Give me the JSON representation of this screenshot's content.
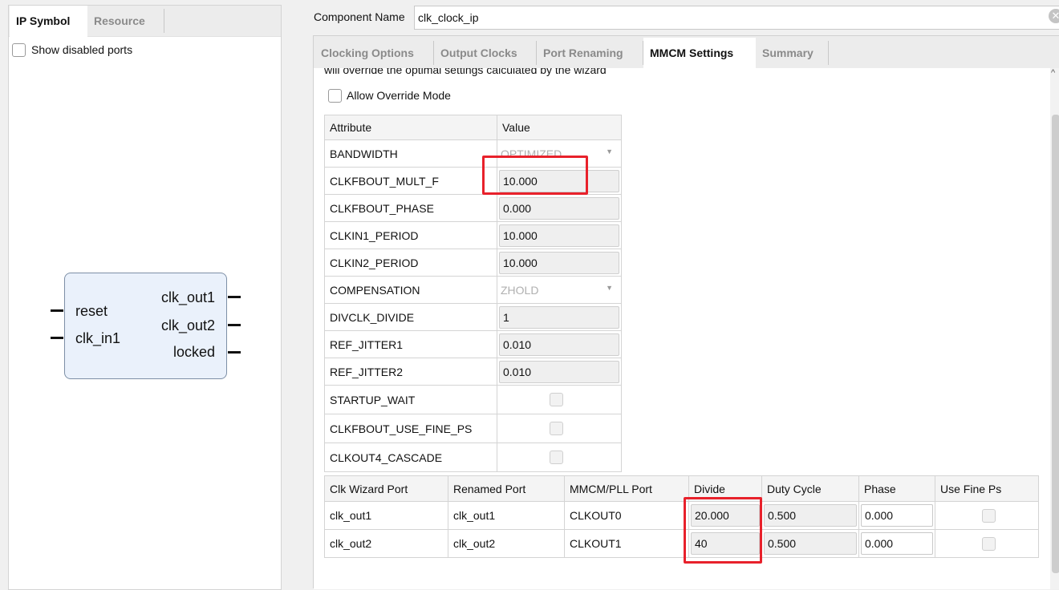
{
  "left_panel": {
    "tabs": [
      {
        "label": "IP Symbol",
        "active": true
      },
      {
        "label": "Resource",
        "active": false
      }
    ],
    "show_disabled_ports": {
      "label": "Show disabled ports",
      "checked": false
    },
    "symbol": {
      "inputs": [
        "reset",
        "clk_in1"
      ],
      "outputs": [
        "clk_out1",
        "clk_out2",
        "locked"
      ],
      "fill_color": "#eaf1fb"
    }
  },
  "component_name": {
    "label": "Component Name",
    "value": "clk_clock_ip",
    "clear_icon": "clear-circle-icon"
  },
  "tabs": [
    {
      "label": "Clocking Options"
    },
    {
      "label": "Output Clocks"
    },
    {
      "label": "Port Renaming"
    },
    {
      "label": "MMCM Settings",
      "active": true
    },
    {
      "label": "Summary"
    }
  ],
  "mmcm": {
    "note": "will override the optimal settings calculated by the wizard",
    "allow_override": {
      "label": "Allow Override Mode",
      "checked": false
    },
    "attr_table": {
      "headers": [
        "Attribute",
        "Value"
      ],
      "rows": [
        {
          "name": "BANDWIDTH",
          "value": "OPTIMIZED",
          "kind": "combo"
        },
        {
          "name": "CLKFBOUT_MULT_F",
          "value": "10.000",
          "kind": "text"
        },
        {
          "name": "CLKFBOUT_PHASE",
          "value": "0.000",
          "kind": "text"
        },
        {
          "name": "CLKIN1_PERIOD",
          "value": "10.000",
          "kind": "text"
        },
        {
          "name": "CLKIN2_PERIOD",
          "value": "10.000",
          "kind": "text"
        },
        {
          "name": "COMPENSATION",
          "value": "ZHOLD",
          "kind": "combo"
        },
        {
          "name": "DIVCLK_DIVIDE",
          "value": "1",
          "kind": "text"
        },
        {
          "name": "REF_JITTER1",
          "value": "0.010",
          "kind": "text"
        },
        {
          "name": "REF_JITTER2",
          "value": "0.010",
          "kind": "text"
        },
        {
          "name": "STARTUP_WAIT",
          "value": "",
          "kind": "check"
        },
        {
          "name": "CLKFBOUT_USE_FINE_PS",
          "value": "",
          "kind": "check"
        },
        {
          "name": "CLKOUT4_CASCADE",
          "value": "",
          "kind": "check"
        }
      ]
    },
    "out_table": {
      "headers": [
        "Clk Wizard Port",
        "Renamed Port",
        "MMCM/PLL Port",
        "Divide",
        "Duty Cycle",
        "Phase",
        "Use Fine Ps"
      ],
      "rows": [
        [
          "clk_out1",
          "clk_out1",
          "CLKOUT0",
          "20.000",
          "0.500",
          "0.000"
        ],
        [
          "clk_out2",
          "clk_out2",
          "CLKOUT1",
          "40",
          "0.500",
          "0.000"
        ]
      ]
    }
  },
  "highlight_color": "#e8212b"
}
